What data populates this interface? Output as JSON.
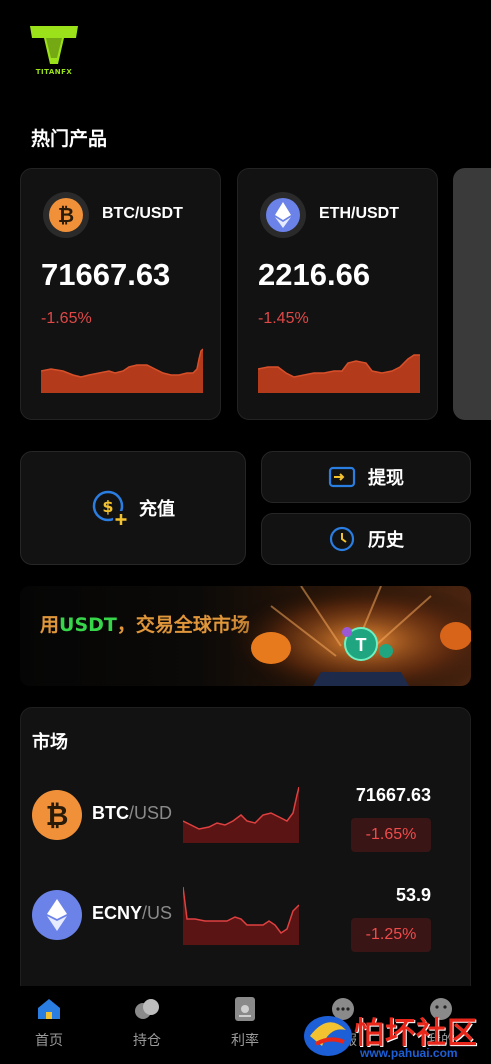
{
  "logo": {
    "text": "TITANFX",
    "color": "#9be21b"
  },
  "hot_section": {
    "title": "热门产品"
  },
  "hot_cards": [
    {
      "pair": "BTC/USDT",
      "price": "71667.63",
      "change": "-1.65%",
      "icon": "bitcoin-icon"
    },
    {
      "pair": "ETH/USDT",
      "price": "2216.66",
      "change": "-1.45%",
      "icon": "ethereum-icon"
    }
  ],
  "actions": {
    "deposit_label": "充值",
    "withdraw_label": "提现",
    "history_label": "历史"
  },
  "banner": {
    "prefix": "用",
    "highlight": "USDT",
    "suffix": "，交易全球市场"
  },
  "market": {
    "title": "市场",
    "rows": [
      {
        "name": "BTC",
        "sub": "/USDT",
        "price": "71667.63",
        "change": "-1.65%",
        "icon": "bitcoin-icon"
      },
      {
        "name": "ECNY",
        "sub": "/USDT",
        "price": "53.9",
        "change": "-1.25%",
        "icon": "ethereum-icon"
      }
    ]
  },
  "tabs": [
    {
      "label": "首页",
      "icon": "home-icon",
      "active": true
    },
    {
      "label": "持仓",
      "icon": "coins-icon",
      "active": false
    },
    {
      "label": "利率",
      "icon": "rate-icon",
      "active": false
    },
    {
      "label": "客服",
      "icon": "chat-icon",
      "active": false
    },
    {
      "label": "我的",
      "icon": "profile-icon",
      "active": false
    }
  ],
  "watermark": {
    "text": "怕坏社区",
    "url": "www.pahuai.com"
  },
  "colors": {
    "accent": "#2a7de1",
    "down": "#e04848",
    "spark_fill": "#b43a1c",
    "highlight_green": "#37d64a",
    "banner_text": "#e0963a"
  }
}
